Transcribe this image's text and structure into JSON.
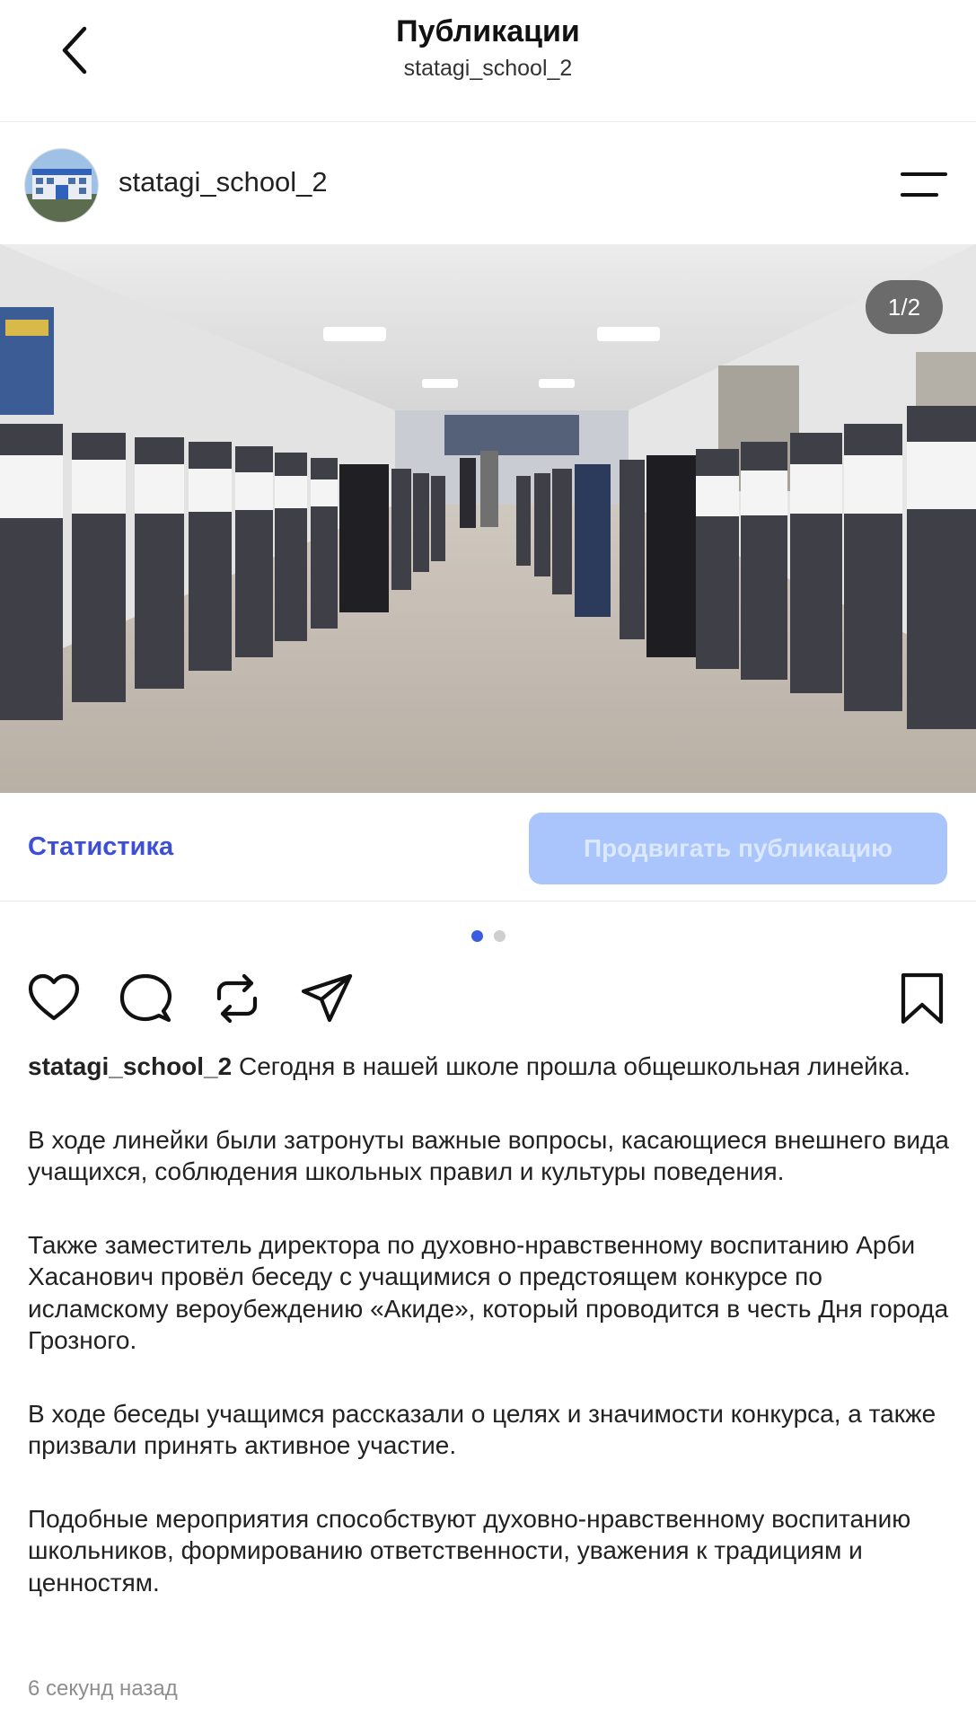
{
  "header": {
    "title": "Публикации",
    "subtitle": "statagi_school_2"
  },
  "post": {
    "username": "statagi_school_2",
    "image_counter": "1/2",
    "current_image": 1,
    "total_images": 2
  },
  "actions": {
    "statistics_label": "Статистика",
    "promote_label": "Продвигать публикацию"
  },
  "caption": {
    "username": "statagi_school_2",
    "first_line": "Сегодня в нашей школе прошла общешкольная линейка.",
    "paragraphs": [
      "В ходе линейки были затронуты важные вопросы, касающиеся внешнего вида учащихся, соблюдения школьных правил и культуры поведения.",
      "Также заместитель директора по духовно-нравственному воспитанию Арби Хасанович провёл беседу с учащимися о предстоящем конкурсе по исламскому вероубеждению «Акиде», который проводится в честь Дня города Грозного.",
      "В ходе беседы учащимся рассказали о целях и значимости конкурса, а также призвали принять активное участие.",
      "Подобные мероприятия способствуют духовно-нравственному воспитанию школьников, формированию ответственности, уважения к традициям и ценностям."
    ]
  },
  "timestamp": "6 секунд назад",
  "colors": {
    "accent": "#3d4fd6",
    "promote_bg": "#a9c5fb",
    "dot_active": "#3b5ce3"
  },
  "icons": [
    "back-icon",
    "menu-icon",
    "heart-icon",
    "comment-icon",
    "repost-icon",
    "share-icon",
    "bookmark-icon"
  ]
}
